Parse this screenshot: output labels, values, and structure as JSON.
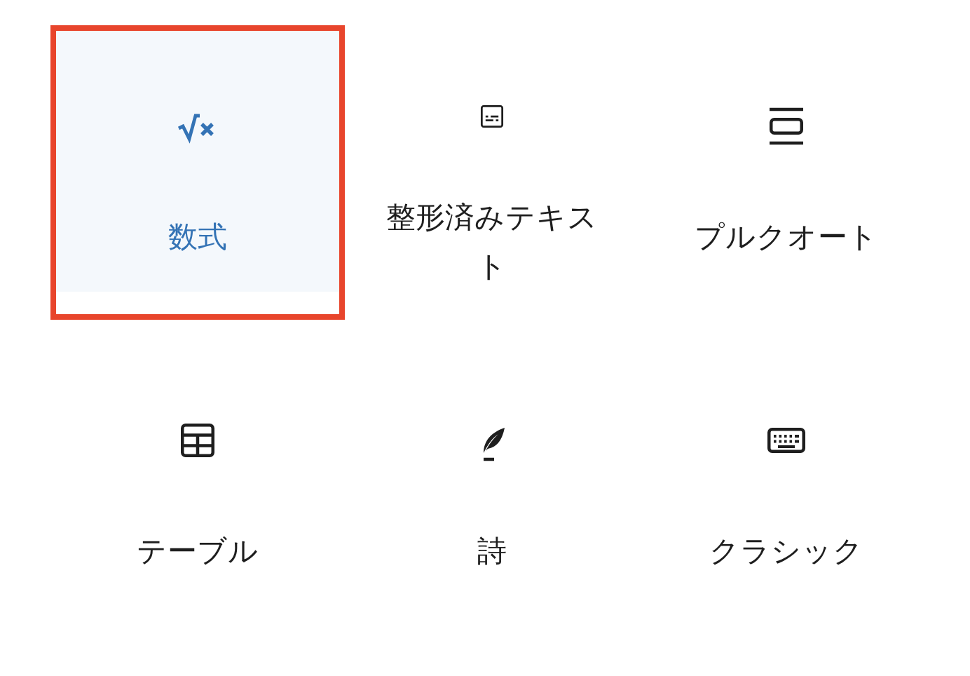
{
  "blocks": [
    {
      "kind": "math",
      "label": "数式",
      "selected": true
    },
    {
      "kind": "preformatted",
      "label": "整形済みテキスト",
      "selected": false
    },
    {
      "kind": "pullquote",
      "label": "プルクオート",
      "selected": false
    },
    {
      "kind": "table",
      "label": "テーブル",
      "selected": false
    },
    {
      "kind": "verse",
      "label": "詩",
      "selected": false
    },
    {
      "kind": "classic",
      "label": "クラシック",
      "selected": false
    }
  ]
}
